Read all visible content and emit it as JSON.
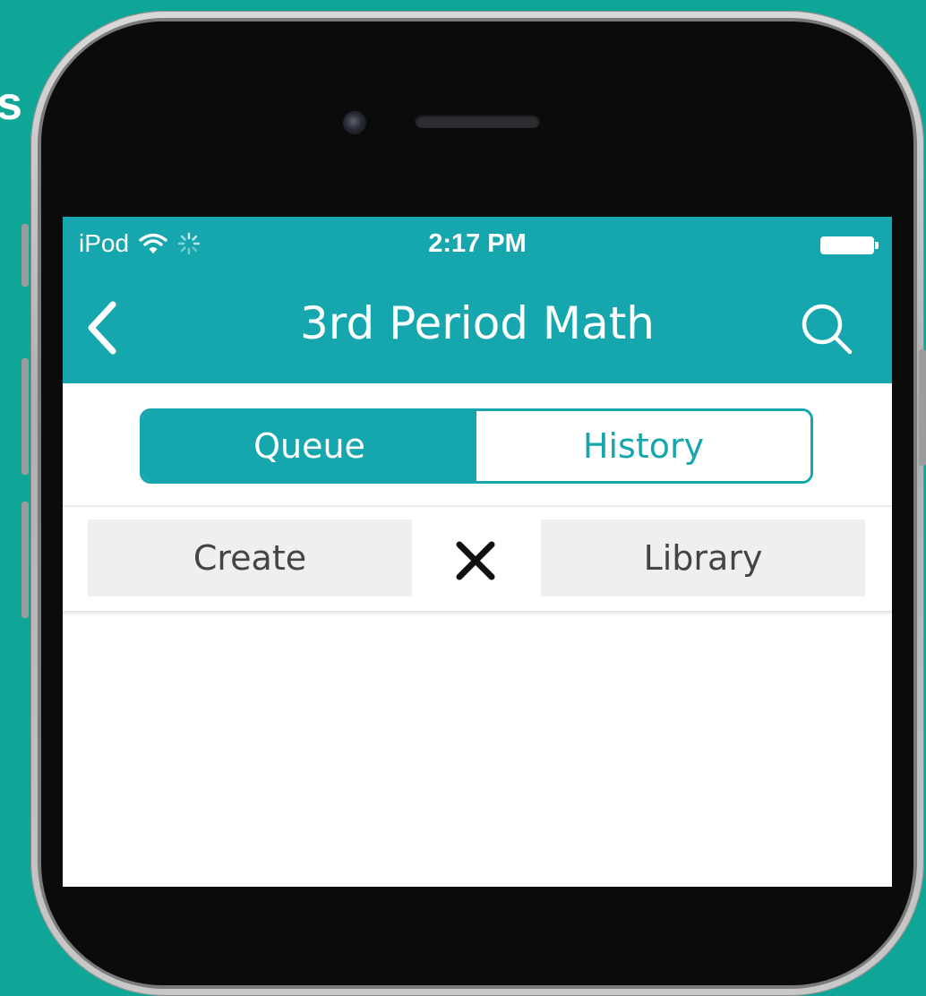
{
  "background_text": "s",
  "status_bar": {
    "carrier": "iPod",
    "time": "2:17 PM",
    "icons": [
      "wifi-icon",
      "activity-spinner-icon",
      "battery-icon"
    ]
  },
  "nav": {
    "title": "3rd Period Math",
    "back_icon": "chevron-left-icon",
    "search_icon": "search-icon"
  },
  "segmented": {
    "options": [
      "Queue",
      "History"
    ],
    "selected": "Queue"
  },
  "actions": {
    "create_label": "Create",
    "library_label": "Library",
    "close_icon": "close-icon"
  },
  "colors": {
    "accent": "#16a6ad",
    "page_background": "#0fa597",
    "button_bg": "#efefef"
  }
}
